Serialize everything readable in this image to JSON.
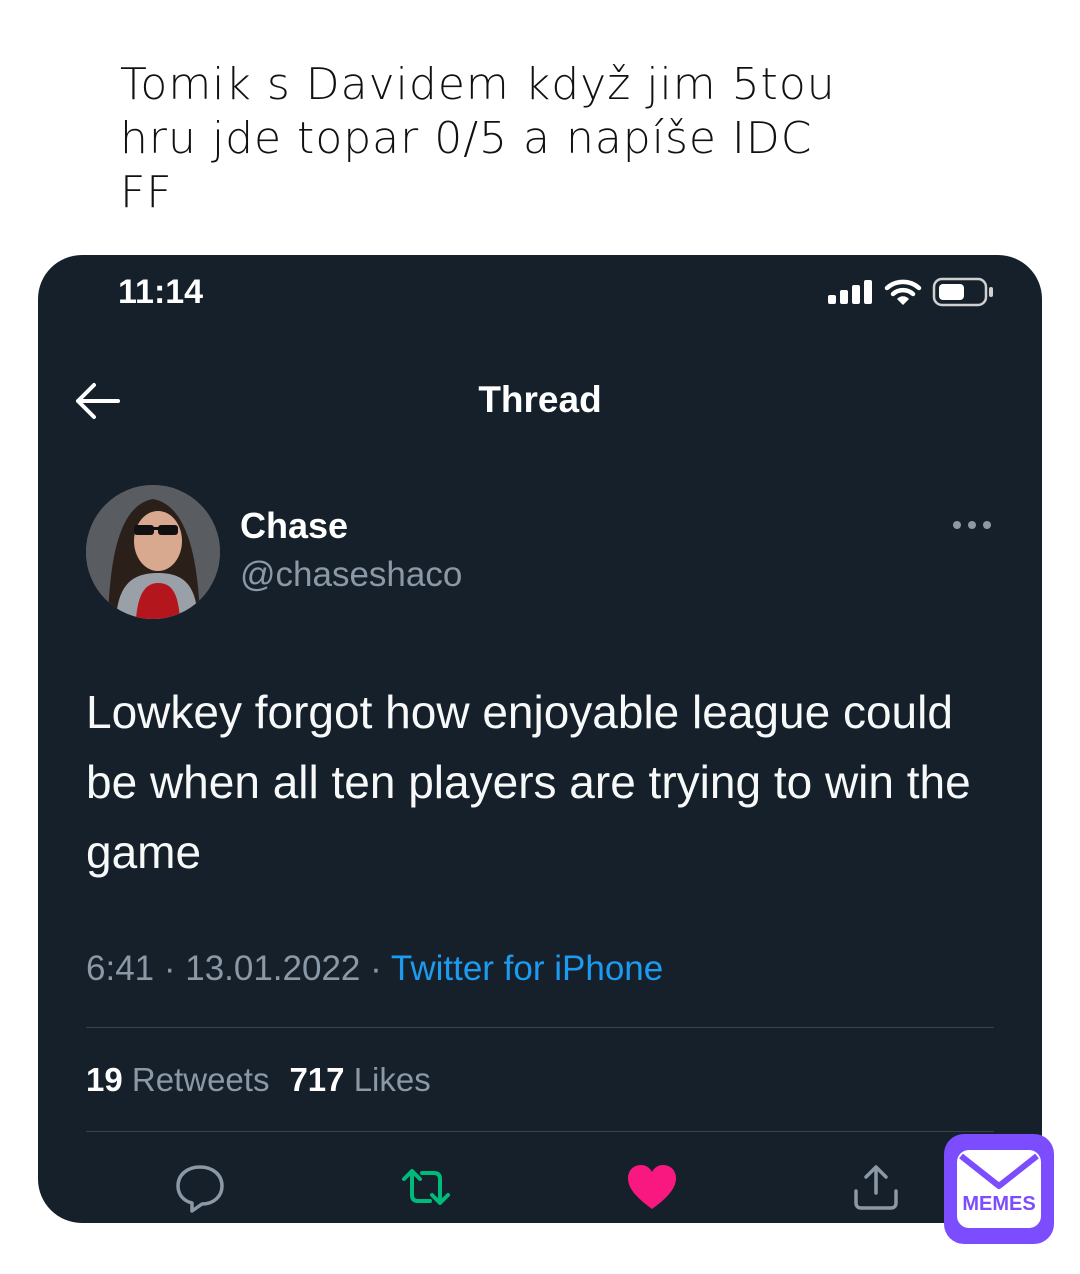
{
  "caption": "Tomik s Davidem když jim 5tou\nhru jde topar 0/5 a napíše IDC\nFF",
  "status_bar": {
    "time": "11:14"
  },
  "nav": {
    "title": "Thread"
  },
  "tweet": {
    "author_name": "Chase",
    "author_handle": "@chaseshaco",
    "text": "Lowkey forgot how enjoyable league could be when all ten players are trying to win the game",
    "timestamp": "6:41 · 13.01.2022 · ",
    "source": "Twitter for iPhone",
    "retweets_count": "19",
    "retweets_label": "Retweets",
    "likes_count": "717",
    "likes_label": "Likes"
  },
  "actions": [
    "reply-icon",
    "retweet-icon",
    "like-icon",
    "share-icon"
  ],
  "colors": {
    "background": "#15202b",
    "text_secondary": "#8b98a5",
    "link": "#1d9bf0",
    "retweet_active": "#00ba7c",
    "like_active": "#f91880",
    "badge": "#7c4dff"
  },
  "watermark": {
    "label": "MEMES"
  }
}
